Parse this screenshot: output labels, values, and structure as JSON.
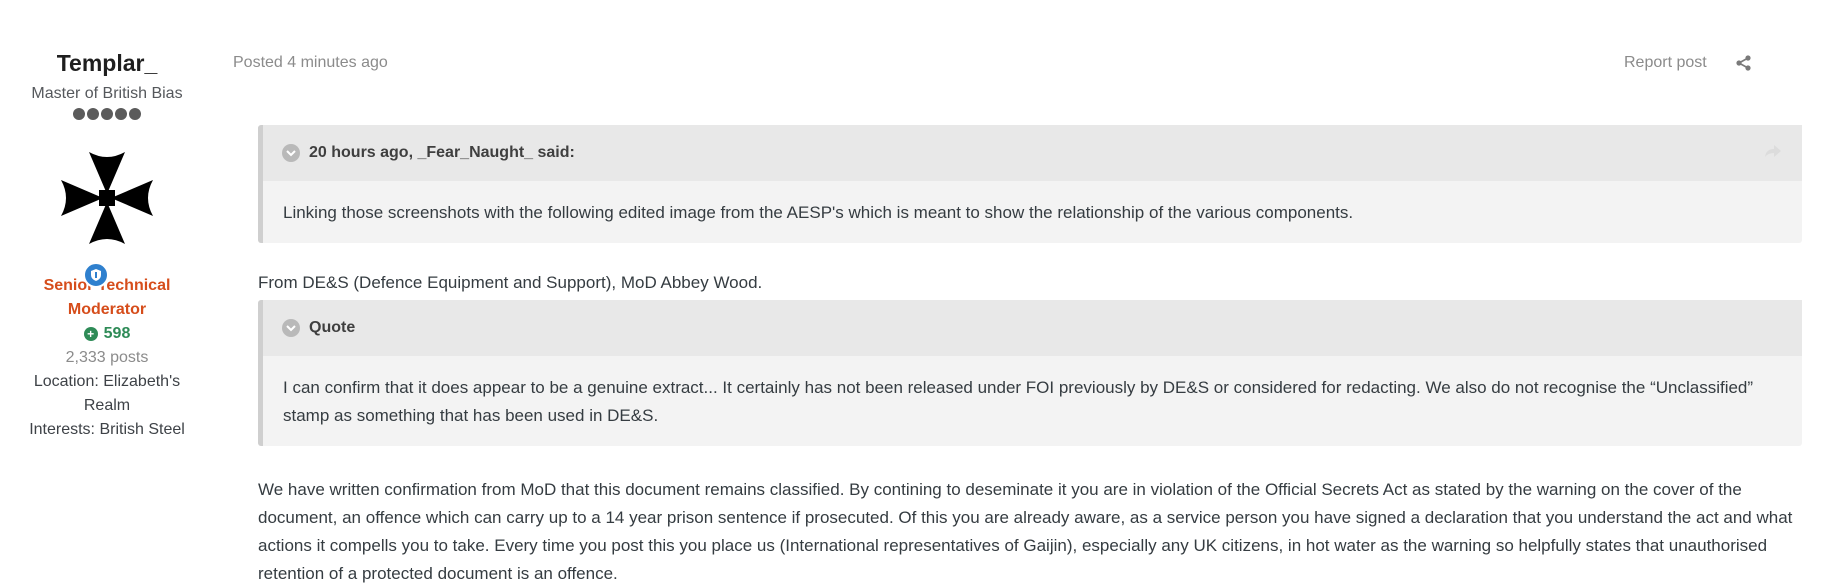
{
  "author": {
    "name": "Templar_",
    "title": "Master of British Bias",
    "pips": 5,
    "group": "Senior Technical Moderator",
    "reputation": "598",
    "posts": "2,333 posts",
    "location": "Location: Elizabeth's Realm",
    "interests": "Interests: British Steel"
  },
  "post": {
    "posted": "Posted 4 minutes ago",
    "report": "Report post",
    "quote1": {
      "header": "20 hours ago, _Fear_Naught_ said:",
      "body": "Linking those screenshots with the following edited image from the AESP's which is meant to show the relationship of the various components."
    },
    "para1": "From DE&S (Defence Equipment and Support), MoD Abbey Wood.",
    "quote2": {
      "header": "Quote",
      "body": "I can confirm that it does appear to be a genuine extract...  It certainly has not been released under FOI previously by DE&S or considered for redacting.  We also do not recognise the “Unclassified” stamp as something that has been used in DE&S."
    },
    "para2": "We have written confirmation from MoD that this document remains classified. By contining to deseminate it you are in violation of the Official Secrets Act as stated by the warning on the cover of the document, an offence which can carry up to a 14 year prison sentence if prosecuted. Of this you are already aware, as a service person you have signed a declaration that you understand the act and what actions it compells you to take. Every time you post this you place us (International representatives of Gaijin), especially any UK citizens, in hot water as the warning so helpfully states that unauthorised retention of a protected document is an offence."
  },
  "colors": {
    "group": "#d64d1b",
    "reputation": "#2e8b57",
    "badge": "#2f80ce"
  },
  "icons": [
    "cross-pattee-avatar",
    "shield-badge-icon",
    "plus-circle-icon",
    "share-icon",
    "chevron-down-icon",
    "quote-link-icon"
  ]
}
